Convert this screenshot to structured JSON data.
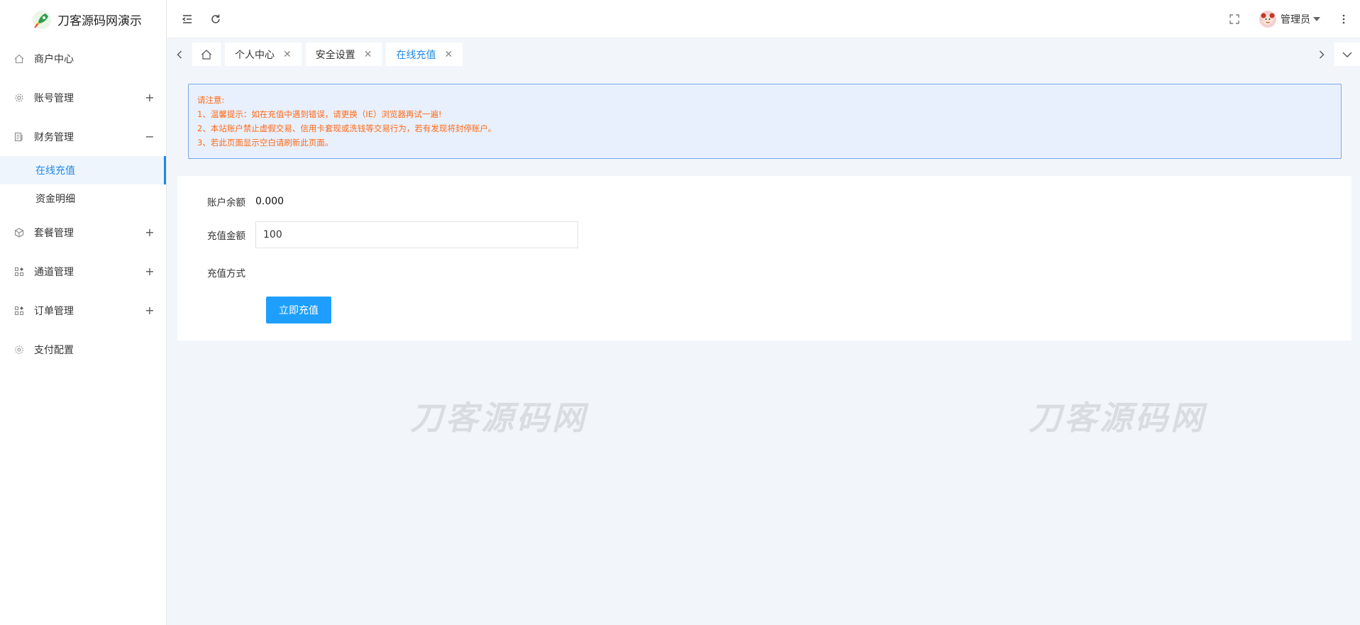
{
  "app": {
    "title": "刀客源码网演示"
  },
  "sidebar": {
    "items": [
      {
        "label": "商户中心",
        "icon": "home-icon",
        "toggle": ""
      },
      {
        "label": "账号管理",
        "icon": "gear-icon",
        "toggle": "+"
      },
      {
        "label": "财务管理",
        "icon": "ledger-icon",
        "toggle": "−"
      },
      {
        "label": "套餐管理",
        "icon": "cube-icon",
        "toggle": "+"
      },
      {
        "label": "通道管理",
        "icon": "apps-icon",
        "toggle": "+"
      },
      {
        "label": "订单管理",
        "icon": "apps-icon",
        "toggle": "+"
      },
      {
        "label": "支付配置",
        "icon": "settings-icon",
        "toggle": ""
      }
    ],
    "finance_sub": [
      {
        "label": "在线充值",
        "active": true
      },
      {
        "label": "资金明细",
        "active": false
      }
    ]
  },
  "header": {
    "user_name": "管理员"
  },
  "tabs": [
    {
      "label": "个人中心",
      "close": "✕"
    },
    {
      "label": "安全设置",
      "close": "✕"
    },
    {
      "label": "在线充值",
      "close": "✕",
      "active": true
    }
  ],
  "notice": {
    "lines": [
      "请注意:",
      "1、温馨提示：如在充值中遇到错误，请更换（IE）浏览器再试一遍!",
      "2、本站账户禁止虚假交易、信用卡套现或洗钱等交易行为，若有发现将封停账户。",
      "3、若此页面显示空白请刷新此页面。"
    ]
  },
  "form": {
    "balance_label": "账户余额",
    "balance_value": "0.000",
    "amount_label": "充值金额",
    "amount_value": "100",
    "method_label": "充值方式",
    "submit_label": "立即充值"
  },
  "watermark": {
    "text": "刀客源码网"
  },
  "colors": {
    "accent": "#1e88e5",
    "button": "#1e9fff",
    "notice_text": "#ff6a13",
    "notice_bg": "#e8f0fe"
  }
}
